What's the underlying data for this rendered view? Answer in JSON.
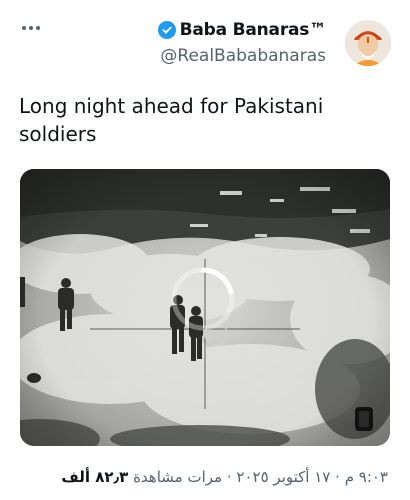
{
  "author": {
    "display_name": "Baba Banaras™",
    "handle": "@RealBababanaras",
    "verified": true
  },
  "tweet": {
    "text_line1": "Long night ahead for Pakistani",
    "text_line2": "soldiers"
  },
  "meta": {
    "time": "٩:٠٣ م",
    "separator1": "·",
    "date": "١٧ أكتوبر ٢٠٢٥",
    "separator2": "·",
    "views_count": "٨٢٫٣ ألف",
    "views_label": "مرات مشاهدة"
  },
  "colors": {
    "verified_blue": "#1d9bf0",
    "secondary_text": "#536471",
    "primary_text": "#0f1419"
  },
  "icons": [
    "more-options-icon",
    "verified-badge-icon",
    "loading-spinner-icon",
    "video-settings-icon"
  ]
}
